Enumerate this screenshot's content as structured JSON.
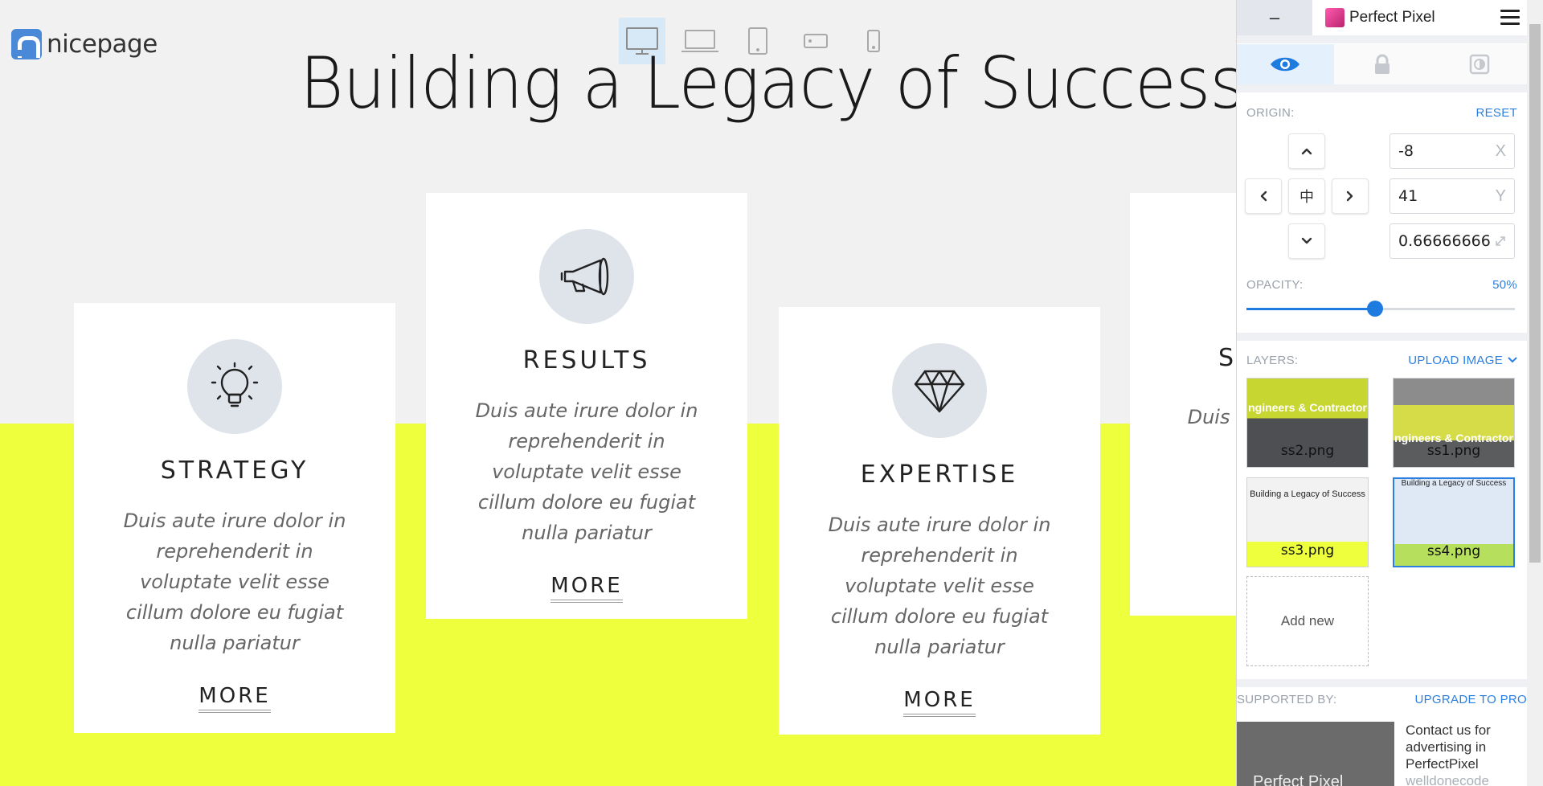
{
  "site": {
    "logo_text": "nicepage",
    "title": "Building a Legacy of Success",
    "devices": [
      "desktop",
      "laptop",
      "tablet",
      "phone-landscape",
      "phone"
    ]
  },
  "cards": [
    {
      "icon": "lightbulb-icon",
      "title": "STRATEGY",
      "text": "Duis aute irure dolor in reprehenderit in voluptate velit esse cillum dolore eu fugiat nulla pariatur",
      "more": "MORE"
    },
    {
      "icon": "megaphone-icon",
      "title": "RESULTS",
      "text": "Duis aute irure dolor in reprehenderit in voluptate velit esse cillum dolore eu fugiat nulla pariatur",
      "more": "MORE"
    },
    {
      "icon": "diamond-icon",
      "title": "EXPERTISE",
      "text": "Duis aute irure dolor in reprehenderit in voluptate velit esse cillum dolore eu fugiat nulla pariatur",
      "more": "MORE"
    },
    {
      "icon": "",
      "title": "S",
      "text": "Duis a repreh velit es fugi",
      "more": ""
    }
  ],
  "colors": {
    "accent_yellow": "#eeff3d",
    "background": "#f1f1f1",
    "icon_circle": "#dfe3ea",
    "pp_blue": "#1e7be0"
  },
  "panel": {
    "minimize_label": "–",
    "brand": "Perfect Pixel",
    "modes": [
      "eye-icon",
      "lock-icon",
      "invert-icon"
    ],
    "origin_label": "ORIGIN:",
    "reset_label": "RESET",
    "x_value": "-8",
    "x_unit": "X",
    "y_value": "41",
    "y_unit": "Y",
    "scale_value": "0.66666666",
    "center_glyph": "中",
    "opacity_label": "OPACITY:",
    "opacity_value": "50%",
    "opacity_fraction": 0.48,
    "layers_label": "LAYERS:",
    "upload_label": "UPLOAD IMAGE",
    "layers": [
      {
        "name": "ss2.png",
        "caption": "ngineers & Contractor"
      },
      {
        "name": "ss1.png",
        "caption": "ngineers & Contractor"
      },
      {
        "name": "ss3.png",
        "caption": "Building a Legacy of Success"
      },
      {
        "name": "ss4.png",
        "caption": "Building a Legacy of Success"
      }
    ],
    "add_new_label": "Add new",
    "supported_label": "SUPPORTED BY:",
    "upgrade_label": "UPGRADE TO PRO",
    "ad_brand": "Perfect Pixel",
    "ad_text": "Contact us for advertising in PerfectPixel",
    "ad_sub": "welldonecode"
  }
}
